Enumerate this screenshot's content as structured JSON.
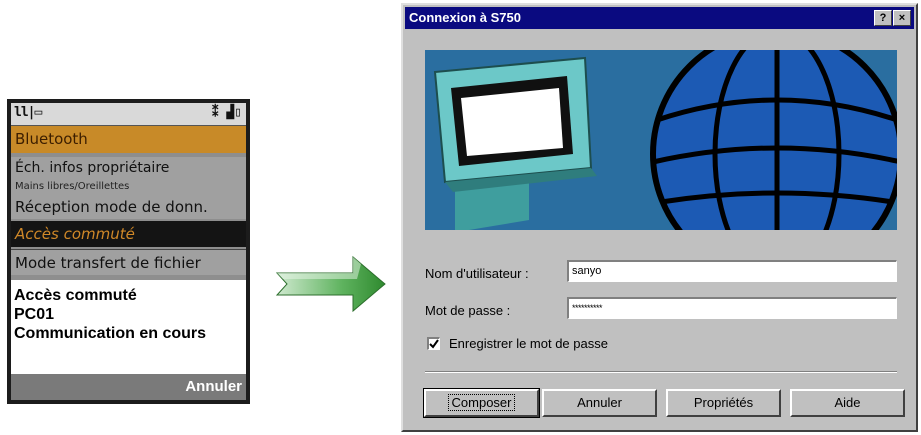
{
  "phone": {
    "status_left": "ll|▭",
    "status_right": "⁑ ▟▯",
    "menu": {
      "bluetooth": "Bluetooth",
      "item1": "Éch. infos propriétaire",
      "item2": "Mains libres/Oreillettes",
      "item3": "Réception mode de donn.",
      "item4": "Accès commuté",
      "item5": "Mode transfert de fichier"
    },
    "info": {
      "line1": "Accès commuté",
      "line2": "PC01",
      "line3": "Communication en cours"
    },
    "softkey": "Annuler"
  },
  "dialog": {
    "title": "Connexion à S750",
    "help_button": "?",
    "close_button": "×",
    "username_label": "Nom d'utilisateur :",
    "username_value": "sanyo",
    "password_label": "Mot de passe :",
    "password_value": "**********",
    "save_password_label": "Enregistrer le mot de passe",
    "save_password_checked": true,
    "buttons": {
      "compose": "Composer",
      "cancel": "Annuler",
      "properties": "Propriétés",
      "help": "Aide"
    }
  },
  "colors": {
    "title_bar": "#0a0a80",
    "dialog_face": "#c0c0c0",
    "banner_sky": "#2a6ea0",
    "globe": "#1c5ab4",
    "arrow": "#3c9a3c",
    "phone_highlight": "#c88a28"
  },
  "icons": {
    "check": "check-icon",
    "arrow": "arrow-right-icon",
    "globe": "globe-icon",
    "monitor": "monitor-icon"
  }
}
